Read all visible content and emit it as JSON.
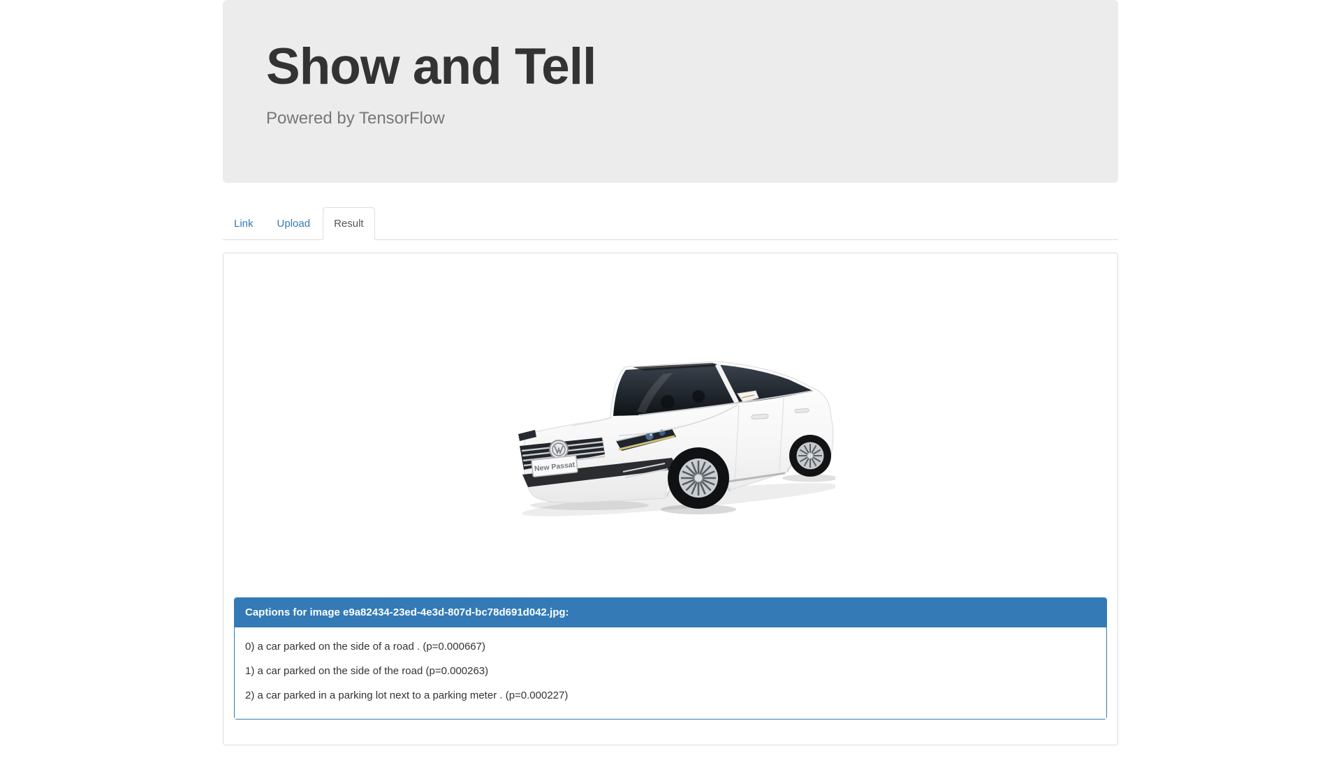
{
  "header": {
    "title": "Show and Tell",
    "subtitle": "Powered by TensorFlow"
  },
  "tabs": [
    {
      "label": "Link",
      "active": false
    },
    {
      "label": "Upload",
      "active": false
    },
    {
      "label": "Result",
      "active": true
    }
  ],
  "result_panel": {
    "image": {
      "alt": "White Volkswagen sedan, front three-quarter studio photo",
      "plate_text": "New Passat"
    },
    "captions": {
      "heading": "Captions for image e9a82434-23ed-4e3d-807d-bc78d691d042.jpg:",
      "items": [
        "0) a car parked on the side of a road . (p=0.000667)",
        "1) a car parked on the side of the road (p=0.000263)",
        "2) a car parked in a parking lot next to a parking meter . (p=0.000227)"
      ]
    }
  },
  "colors": {
    "accent": "#337ab7",
    "jumbotron_bg": "#ececec",
    "panel_border": "#dddddd",
    "title_text": "#333333",
    "subtitle_text": "#777777",
    "tab_active_text": "#555555"
  }
}
